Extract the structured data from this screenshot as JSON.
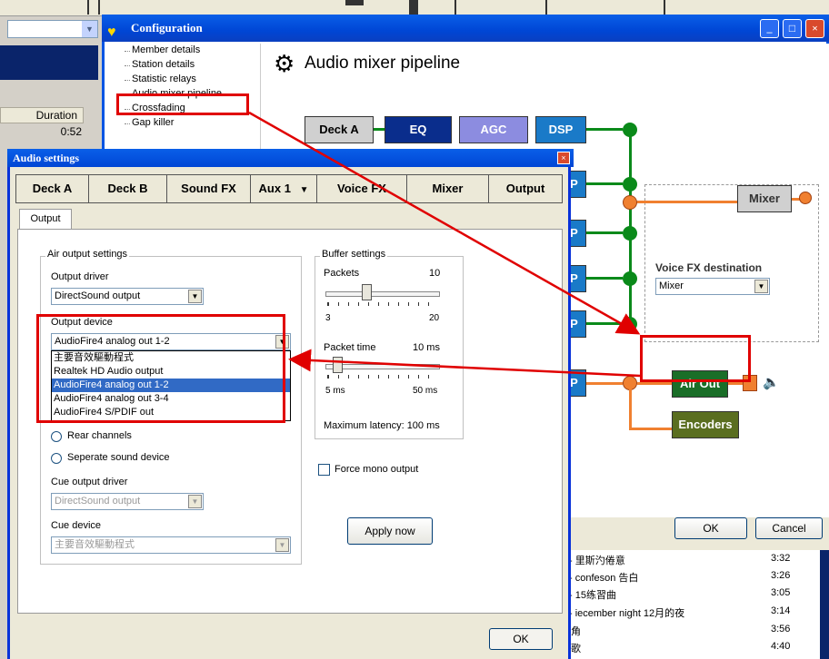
{
  "background": {
    "duration_header": "Duration",
    "duration_values": [
      "0:52"
    ],
    "songs": [
      {
        "title": "- 里斯汋倦意",
        "time": "3:32"
      },
      {
        "title": "- confeson 告白",
        "time": "3:26"
      },
      {
        "title": "- 15练習曲",
        "time": "3:05"
      },
      {
        "title": "- iecember night 12月的夜",
        "time": "3:14"
      },
      {
        "title": "角",
        "time": "3:56"
      },
      {
        "title": "歌",
        "time": "4:40"
      }
    ]
  },
  "config_window": {
    "title": "Configuration",
    "tree": [
      "Member details",
      "Station details",
      "Statistic relays",
      "Audio mixer pipeline",
      "Crossfading",
      "Gap killer"
    ],
    "heading": "Audio mixer pipeline",
    "pipeline": {
      "deck_a": "Deck A",
      "eq": "EQ",
      "agc": "AGC",
      "dsp": "DSP",
      "dsp_partial": "P",
      "mixer": "Mixer",
      "air_out": "Air Out",
      "encoders": "Encoders"
    },
    "voice_fx_label": "Voice FX destination",
    "voice_fx_value": "Mixer",
    "ok": "OK",
    "cancel": "Cancel",
    "colors": {
      "titlebar": "#0046d5",
      "eq": "#0a2d8c",
      "agc": "#8c8ce0",
      "dsp": "#1a7ac8",
      "air_out": "#1a6e28",
      "encoders": "#5a6e20",
      "pipe": "#0a8a1a",
      "orange": "#f08030"
    }
  },
  "audio_window": {
    "title": "Audio settings",
    "tabs": [
      "Deck A",
      "Deck B",
      "Sound FX",
      "Aux 1",
      "Voice FX",
      "Mixer",
      "Output"
    ],
    "subtab": "Output",
    "air_group": "Air output settings",
    "output_driver_label": "Output driver",
    "output_driver_value": "DirectSound output",
    "output_device_label": "Output device",
    "output_device_value": "AudioFire4 analog out 1-2",
    "device_options": [
      "主要音效驅動程式",
      "Realtek HD Audio output",
      "AudioFire4 analog out 1-2",
      "AudioFire4 analog out 3-4",
      "AudioFire4 S/PDIF out"
    ],
    "selected_option": "AudioFire4 analog out 1-2",
    "radio_rear": "Rear channels",
    "radio_separate": "Seperate sound device",
    "cue_driver_label": "Cue output driver",
    "cue_driver_value": "DirectSound output",
    "cue_device_label": "Cue device",
    "cue_device_value": "主要音效驅動程式",
    "buffer_group": "Buffer settings",
    "packets_label": "Packets",
    "packets_value": "10",
    "packets_min": "3",
    "packets_max": "20",
    "packet_time_label": "Packet time",
    "packet_time_value": "10 ms",
    "packet_time_min": "5 ms",
    "packet_time_max": "50 ms",
    "latency": "Maximum latency: 100 ms",
    "force_mono": "Force mono output",
    "apply": "Apply now",
    "ok": "OK"
  }
}
